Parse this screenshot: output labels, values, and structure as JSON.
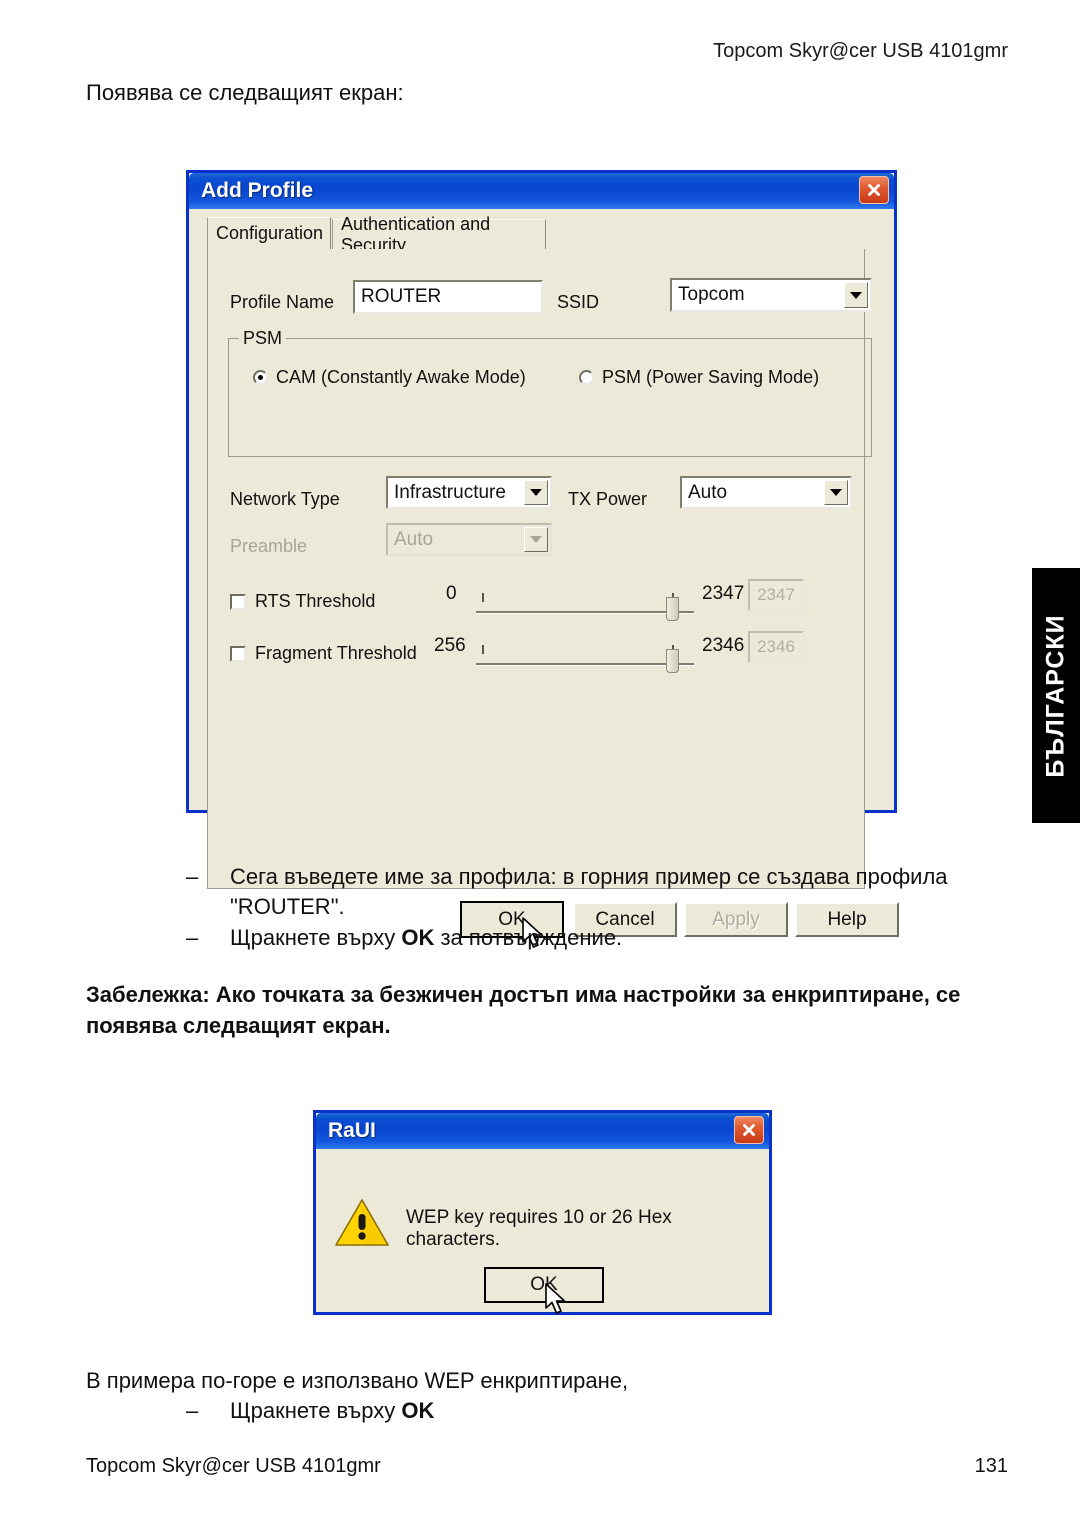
{
  "page": {
    "header_right": "Topcom Skyr@cer USB 4101gmr",
    "intro": "Появява се следващият екран:",
    "language_tab": "БЪЛГАРСКИ",
    "footer_left": "Topcom Skyr@cer USB 4101gmr",
    "footer_page": "131"
  },
  "bullets": [
    {
      "dash": "–",
      "text_before": "Сега въведете име за профила: в горния пример се създава профила \"ROUTER\".",
      "bold": "",
      "text_after": ""
    },
    {
      "dash": "–",
      "text_before": "Щракнете върху ",
      "bold": "OK",
      "text_after": " за потвърждение."
    }
  ],
  "note": "Забележка: Ако точката за безжичен достъп има настройки за енкриптиране, се появява следващият екран.",
  "tail": {
    "line1": "В примера по-горе е използвано WEP енкриптиране,",
    "dash": "–",
    "text_before": "Щракнете върху ",
    "bold": "OK"
  },
  "add_profile": {
    "title": "Add Profile",
    "close_icon": "close-icon",
    "tabs": [
      {
        "label": "Configuration",
        "active": true
      },
      {
        "label": "Authentication and Security",
        "active": false
      }
    ],
    "profile_name": {
      "label": "Profile Name",
      "value": "ROUTER"
    },
    "ssid": {
      "label": "SSID",
      "value": "Topcom"
    },
    "psm": {
      "group_title": "PSM",
      "options": [
        {
          "label": "CAM (Constantly Awake Mode)",
          "selected": true
        },
        {
          "label": "PSM (Power Saving Mode)",
          "selected": false
        }
      ]
    },
    "network_type": {
      "label": "Network Type",
      "value": "Infrastructure"
    },
    "tx_power": {
      "label": "TX Power",
      "value": "Auto"
    },
    "preamble": {
      "label": "Preamble",
      "value": "Auto",
      "disabled": true
    },
    "rts_threshold": {
      "label": "RTS Threshold",
      "checked": false,
      "min": "0",
      "max": "2347",
      "value": "2347"
    },
    "fragment_threshold": {
      "label": "Fragment Threshold",
      "checked": false,
      "min": "256",
      "max": "2346",
      "value": "2346"
    },
    "buttons": [
      {
        "label": "OK",
        "state": "default"
      },
      {
        "label": "Cancel",
        "state": "normal"
      },
      {
        "label": "Apply",
        "state": "disabled"
      },
      {
        "label": "Help",
        "state": "normal"
      }
    ]
  },
  "raui": {
    "title": "RaUI",
    "close_icon": "close-icon",
    "warning_icon": "warning-triangle-icon",
    "message": "WEP key requires 10 or 26 Hex characters.",
    "ok_button": "OK"
  },
  "colors": {
    "titlebar_blue": "#0a45cf",
    "dialog_face": "#ece9d8",
    "dialog_border": "#0a31c8",
    "close_red": "#c83a17",
    "warning_yellow": "#ffd400",
    "lang_tab_bg": "#000000"
  }
}
